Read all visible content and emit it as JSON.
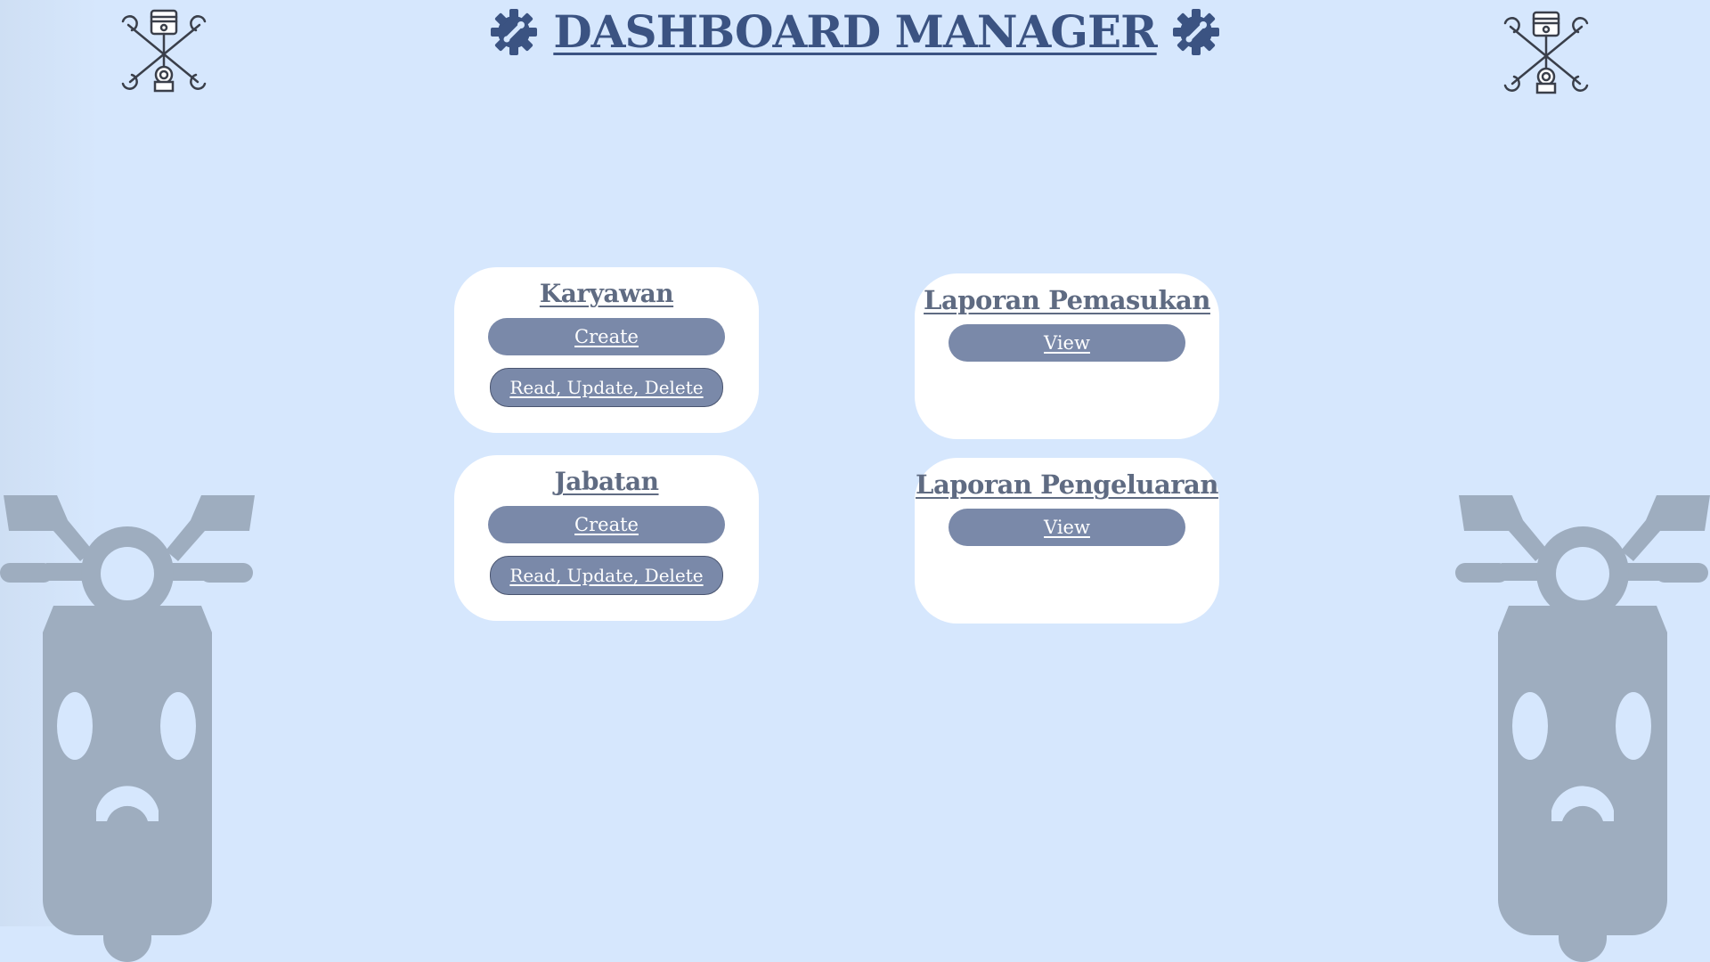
{
  "header": {
    "title": "DASHBOARD MANAGER",
    "left_icon": "gear-icon",
    "right_icon": "gear-icon"
  },
  "decor": {
    "corner_logo": "wrench-piston-icon",
    "side_image": "scooter-icon"
  },
  "cards": {
    "karyawan": {
      "title": "Karyawan",
      "create_label": "Create",
      "rud_label": "Read, Update, Delete"
    },
    "jabatan": {
      "title": "Jabatan",
      "create_label": "Create",
      "rud_label": "Read, Update, Delete"
    },
    "laporan_pemasukan": {
      "title": "Laporan Pemasukan",
      "view_label": "View"
    },
    "laporan_pengeluaran": {
      "title": "Laporan Pengeluaran",
      "view_label": "View"
    }
  },
  "colors": {
    "background": "#d6e7fd",
    "title": "#3b5382",
    "card": "#ffffff",
    "card_title": "#5f6b82",
    "button": "#7a89a9",
    "scooter": "#9eadbf"
  }
}
